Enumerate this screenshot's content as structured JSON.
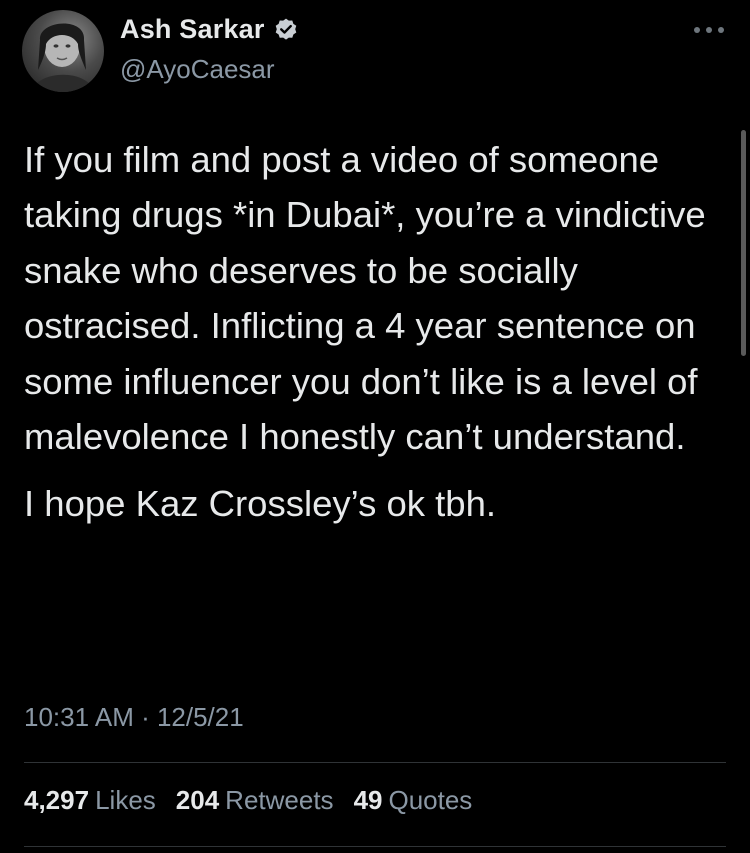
{
  "author": {
    "display_name": "Ash Sarkar",
    "handle": "@AyoCaesar",
    "verified": true,
    "avatar_icon": "profile-photo"
  },
  "tweet": {
    "paragraphs": [
      "If you film and post a video of someone taking drugs *in Dubai*, you’re a vindictive snake who deserves to be socially ostracised. Inflicting a 4 year sentence on some influencer you don’t like is a level of malevolence I honestly can’t understand.",
      "I hope Kaz Crossley’s ok tbh."
    ],
    "timestamp": "10:31 AM · 12/5/21"
  },
  "stats": {
    "likes_count": "4,297",
    "likes_label": "Likes",
    "retweets_count": "204",
    "retweets_label": "Retweets",
    "quotes_count": "49",
    "quotes_label": "Quotes"
  },
  "colors": {
    "background": "#000000",
    "primary_text": "#e7e9ea",
    "secondary_text": "#8b98a5",
    "divider": "#2f3336"
  }
}
